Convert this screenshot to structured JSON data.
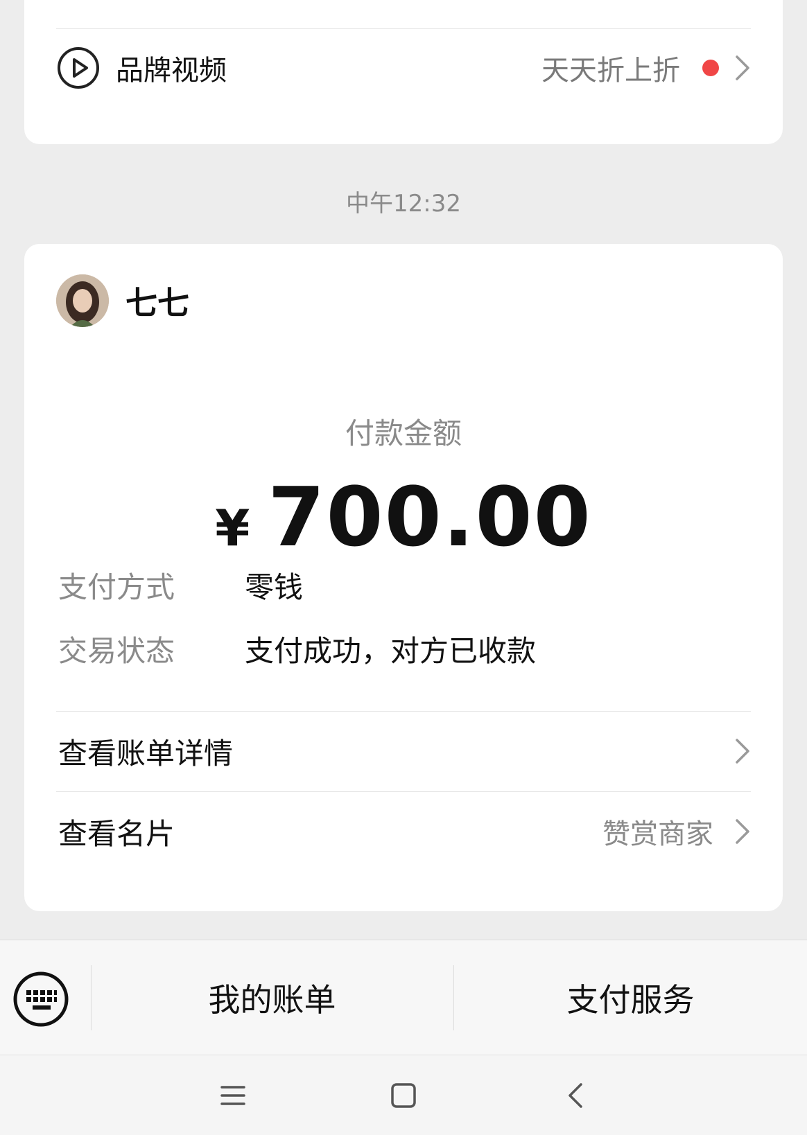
{
  "brand_card": {
    "label": "品牌视频",
    "right_text": "天天折上折",
    "icons": [
      "play-circle-icon",
      "notification-dot",
      "chevron-right-icon"
    ]
  },
  "timestamp": "中午12:32",
  "payment": {
    "payee_name": "七七",
    "amount_label": "付款金额",
    "currency_symbol": "¥",
    "amount": "700.00",
    "details": [
      {
        "key": "支付方式",
        "value": "零钱"
      },
      {
        "key": "交易状态",
        "value": "支付成功，对方已收款"
      }
    ],
    "links": [
      {
        "label": "查看账单详情",
        "right_text": ""
      },
      {
        "label": "查看名片",
        "right_text": "赞赏商家"
      }
    ]
  },
  "menu": {
    "items": [
      "我的账单",
      "支付服务"
    ],
    "icons": [
      "keyboard-icon"
    ]
  },
  "nav": {
    "icons": [
      "menu-icon",
      "home-icon",
      "back-icon"
    ]
  },
  "colors": {
    "background": "#ededed",
    "card": "#ffffff",
    "notification_dot": "#f04646",
    "secondary_text": "#8a8a8a"
  }
}
